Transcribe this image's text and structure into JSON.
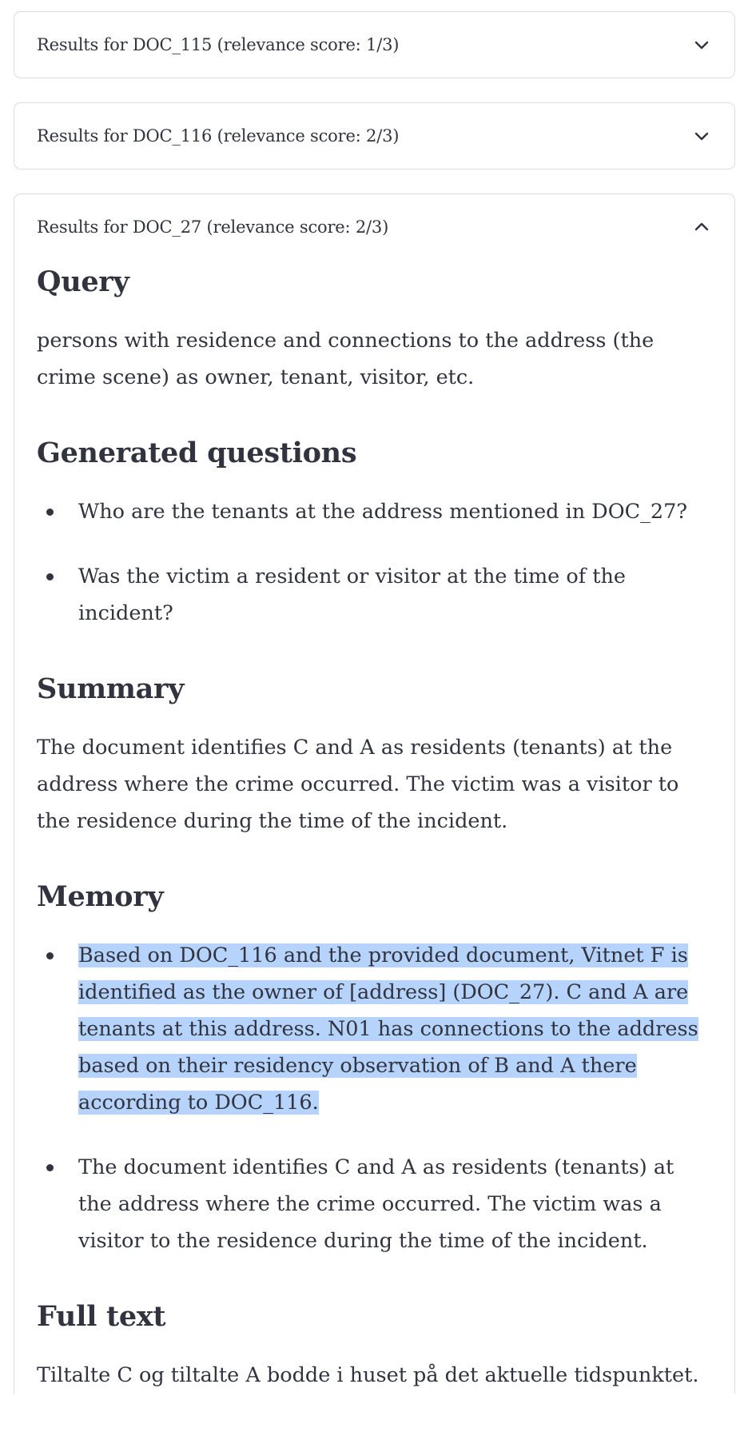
{
  "expanders": [
    {
      "title": "Results for DOC_115 (relevance score: 1/3)",
      "expanded": false
    },
    {
      "title": "Results for DOC_116 (relevance score: 2/3)",
      "expanded": false
    },
    {
      "title": "Results for DOC_27 (relevance score: 2/3)",
      "expanded": true
    }
  ],
  "doc27": {
    "query_heading": "Query",
    "query_text": "persons with residence and connections to the address (the crime scene) as owner, tenant, visitor, etc.",
    "questions_heading": "Generated questions",
    "questions": [
      "Who are the tenants at the address mentioned in DOC_27?",
      "Was the victim a resident or visitor at the time of the incident?"
    ],
    "summary_heading": "Summary",
    "summary_text": "The document identifies C and A as residents (tenants) at the address where the crime occurred. The victim was a visitor to the residence during the time of the incident.",
    "memory_heading": "Memory",
    "memory": [
      "Based on DOC_116 and the provided document, Vitnet F is identified as the owner of [address] (DOC_27). C and A are tenants at this address. N01 has connections to the address based on their residency observation of B and A there according to DOC_116.",
      "The document identifies C and A as residents (tenants) at the address where the crime occurred. The victim was a visitor to the residence during the time of the incident."
    ],
    "fulltext_heading": "Full text",
    "fulltext_text": "Tiltalte C og tiltalte A bodde i huset på det aktuelle tidspunktet."
  },
  "icons": {
    "collapsed": "chevron-down-icon",
    "expanded": "chevron-up-icon"
  },
  "colors": {
    "text": "#31333f",
    "border": "#dcdde2",
    "selection": "#b5d3fb"
  }
}
